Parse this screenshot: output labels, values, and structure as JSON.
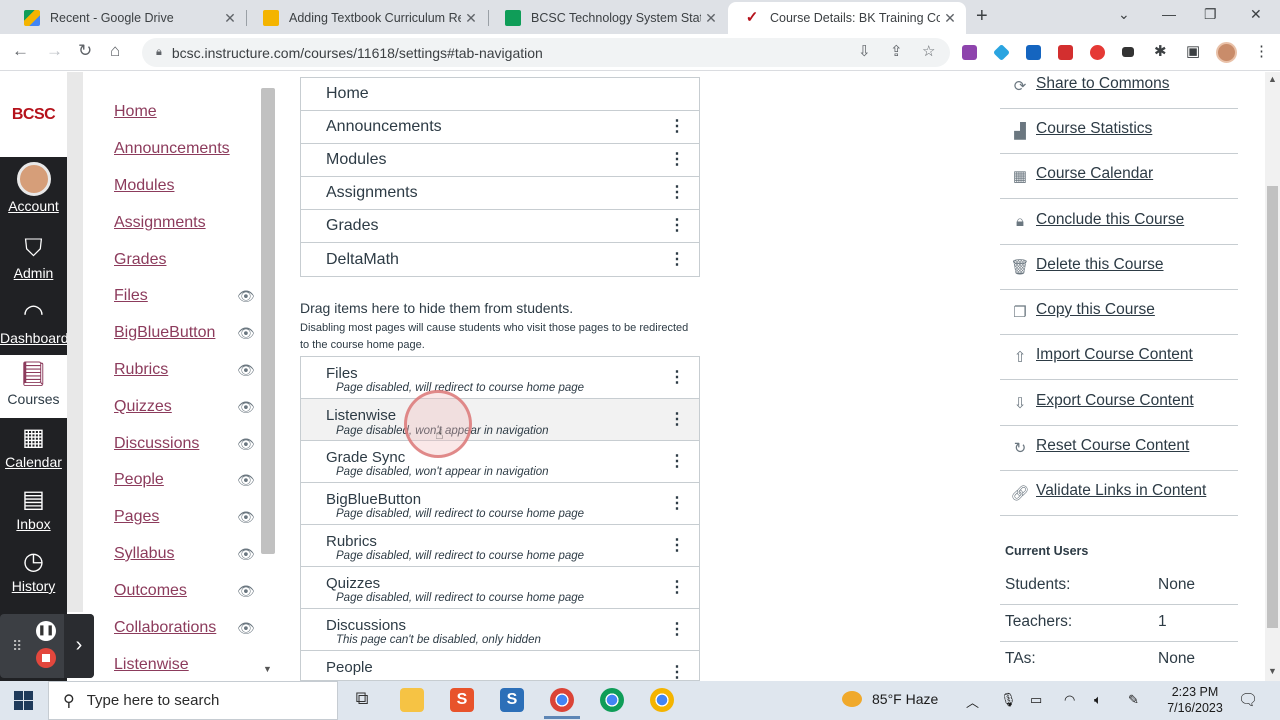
{
  "browser": {
    "tabs": [
      {
        "title": "Recent - Google Drive",
        "favicon_color": "#f2b600"
      },
      {
        "title": "Adding Textbook Curriculum Res",
        "favicon_color": "#f4b400"
      },
      {
        "title": "BCSC Technology System Status",
        "favicon_color": "#0f9d58"
      },
      {
        "title": "Course Details: BK Training Cours",
        "favicon_color": "#b5121b"
      }
    ],
    "url": "bcsc.instructure.com/courses/11618/settings#tab-navigation"
  },
  "global_nav": {
    "logo": "BCSC",
    "items": [
      {
        "label": "Account"
      },
      {
        "label": "Admin"
      },
      {
        "label": "Dashboard"
      },
      {
        "label": "Courses"
      },
      {
        "label": "Calendar"
      },
      {
        "label": "Inbox"
      },
      {
        "label": "History"
      }
    ]
  },
  "course_nav": [
    {
      "label": "Home",
      "hidden": false
    },
    {
      "label": "Announcements",
      "hidden": false
    },
    {
      "label": "Modules",
      "hidden": false
    },
    {
      "label": "Assignments",
      "hidden": false
    },
    {
      "label": "Grades",
      "hidden": false
    },
    {
      "label": "Files",
      "hidden": true
    },
    {
      "label": "BigBlueButton",
      "hidden": true
    },
    {
      "label": "Rubrics",
      "hidden": true
    },
    {
      "label": "Quizzes",
      "hidden": true
    },
    {
      "label": "Discussions",
      "hidden": true
    },
    {
      "label": "People",
      "hidden": true
    },
    {
      "label": "Pages",
      "hidden": true
    },
    {
      "label": "Syllabus",
      "hidden": true
    },
    {
      "label": "Outcomes",
      "hidden": true
    },
    {
      "label": "Collaborations",
      "hidden": true
    },
    {
      "label": "Listenwise",
      "hidden": false
    }
  ],
  "visible_items": [
    "Home",
    "Announcements",
    "Modules",
    "Assignments",
    "Grades",
    "DeltaMath"
  ],
  "hidden_section": {
    "title": "Drag items here to hide them from students.",
    "subtitle": "Disabling most pages will cause students who visit those pages to be redirected to the course home page."
  },
  "hidden_items": [
    {
      "name": "Files",
      "status": "Page disabled, will redirect to course home page"
    },
    {
      "name": "Listenwise",
      "status": "Page disabled, won't appear in navigation"
    },
    {
      "name": "Grade Sync",
      "status": "Page disabled, won't appear in navigation"
    },
    {
      "name": "BigBlueButton",
      "status": "Page disabled, will redirect to course home page"
    },
    {
      "name": "Rubrics",
      "status": "Page disabled, will redirect to course home page"
    },
    {
      "name": "Quizzes",
      "status": "Page disabled, will redirect to course home page"
    },
    {
      "name": "Discussions",
      "status": "This page can't be disabled, only hidden"
    },
    {
      "name": "People",
      "status": ""
    }
  ],
  "sidebar_actions": [
    {
      "label": "Share to Commons",
      "icon": "share-icon"
    },
    {
      "label": "Course Statistics",
      "icon": "bar-chart-icon"
    },
    {
      "label": "Course Calendar",
      "icon": "calendar-icon"
    },
    {
      "label": "Conclude this Course",
      "icon": "lock-icon"
    },
    {
      "label": "Delete this Course",
      "icon": "trash-icon"
    },
    {
      "label": "Copy this Course",
      "icon": "copy-icon"
    },
    {
      "label": "Import Course Content",
      "icon": "upload-icon"
    },
    {
      "label": "Export Course Content",
      "icon": "download-icon"
    },
    {
      "label": "Reset Course Content",
      "icon": "reset-icon"
    },
    {
      "label": "Validate Links in Content",
      "icon": "link-icon"
    }
  ],
  "current_users": {
    "title": "Current Users",
    "rows": [
      {
        "key": "Students:",
        "value": "None"
      },
      {
        "key": "Teachers:",
        "value": "1"
      },
      {
        "key": "TAs:",
        "value": "None"
      }
    ]
  },
  "taskbar": {
    "search_placeholder": "Type here to search",
    "weather": "85°F Haze",
    "time": "2:23 PM",
    "date": "7/16/2023"
  }
}
